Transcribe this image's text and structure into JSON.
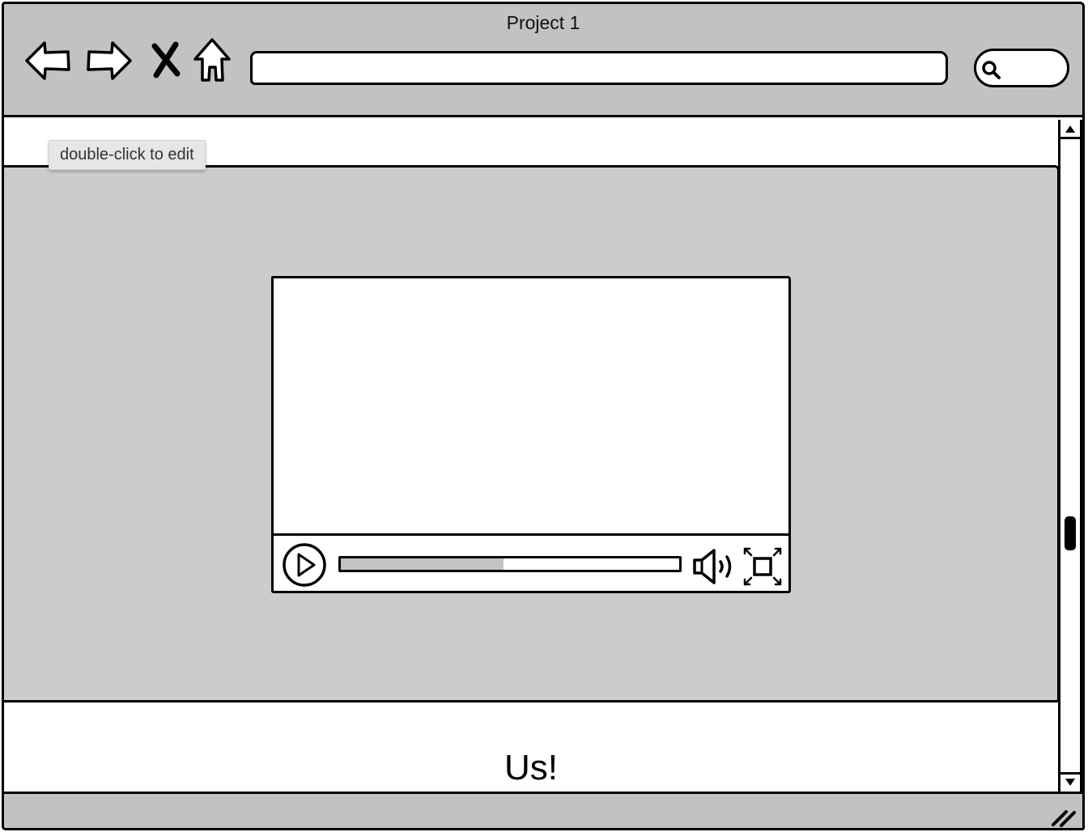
{
  "window": {
    "title": "Project 1"
  },
  "toolbar": {
    "back_icon": "arrow-left-icon",
    "forward_icon": "arrow-right-icon",
    "stop_icon": "close-icon",
    "home_icon": "home-icon",
    "search_icon": "search-icon"
  },
  "address_bar": {
    "value": "",
    "placeholder": ""
  },
  "tooltip": {
    "text": "double-click to edit"
  },
  "video": {
    "progress_fraction": 0.48,
    "play_icon": "play-icon",
    "volume_icon": "volume-icon",
    "fullscreen_icon": "fullscreen-icon"
  },
  "content": {
    "section_heading": "Us!"
  },
  "colors": {
    "chrome": "#c2c2c2",
    "panel": "#cccccc",
    "seek_fill": "#c4c4c4",
    "stroke": "#000000"
  }
}
